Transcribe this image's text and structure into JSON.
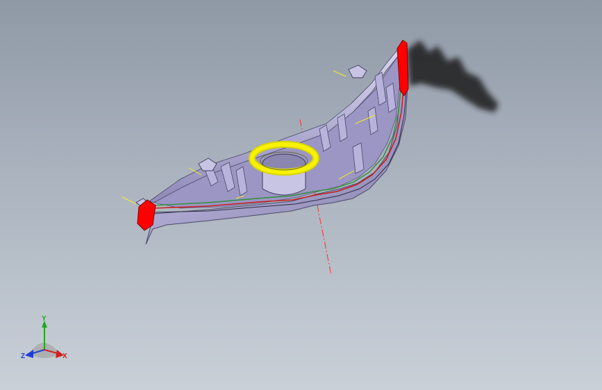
{
  "viewport": {
    "background_top": "#8f99a6",
    "background_bottom": "#c9d0d8"
  },
  "part": {
    "body_color": "#a7a2c9",
    "edge_color": "#4a4766",
    "selected_face_color": "#ff0000",
    "selected_ring_color": "#f2f200",
    "boss_color": "#c8c4e4"
  },
  "triad": {
    "y_label": "Y",
    "x_label": "X",
    "z_label": "Z",
    "y_color": "#1fa81f",
    "x_color": "#d21f1f",
    "z_color": "#1f3fd2"
  }
}
